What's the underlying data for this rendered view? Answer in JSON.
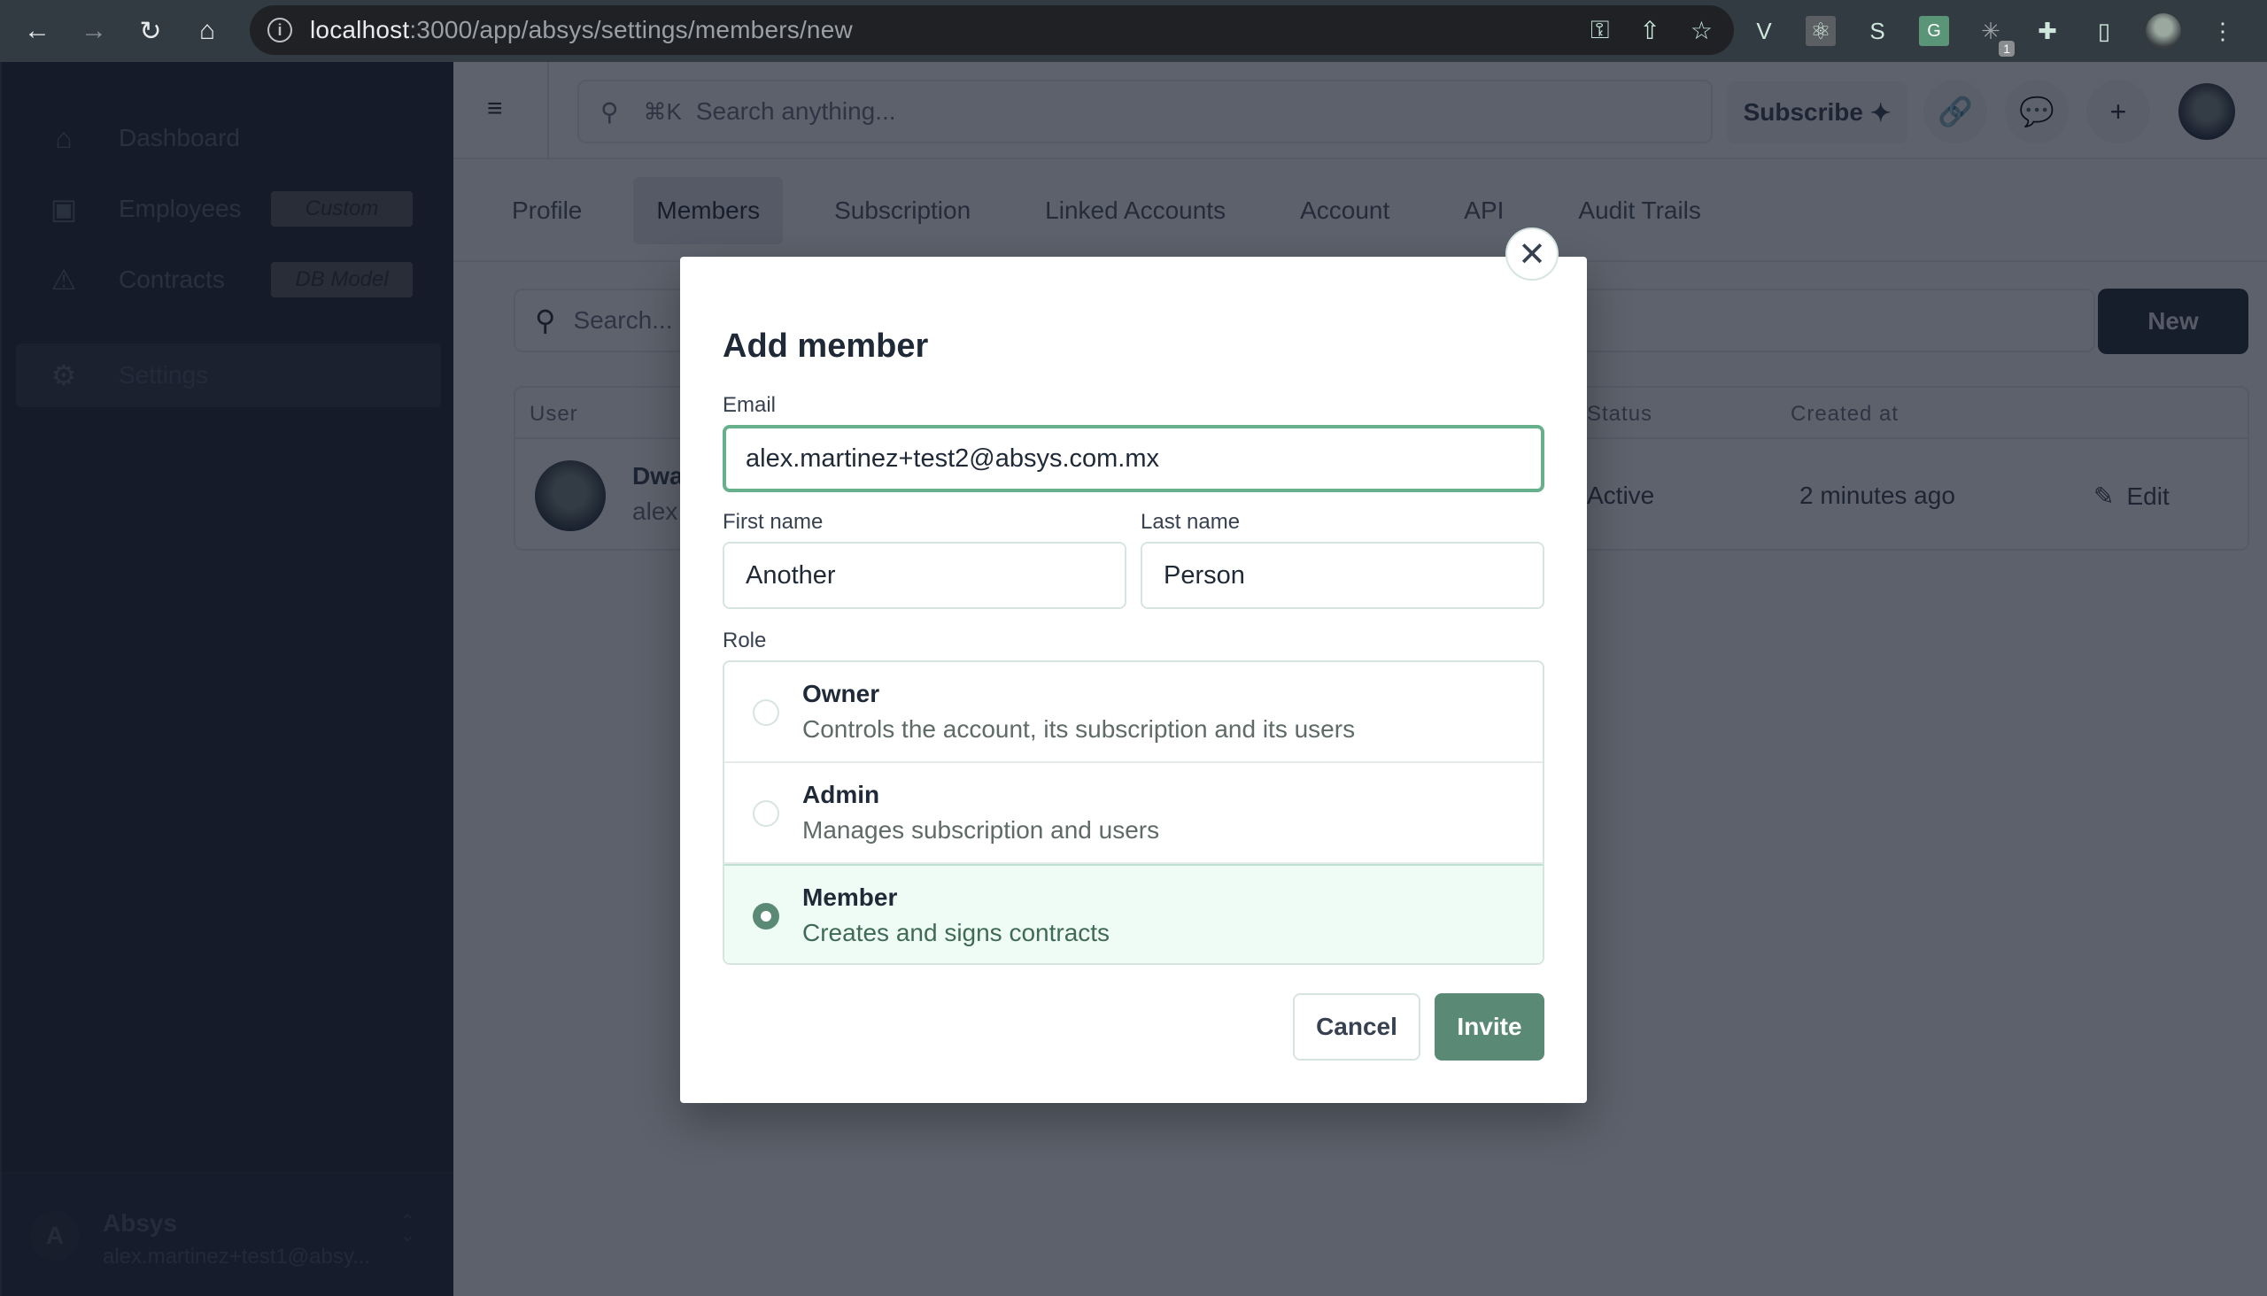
{
  "browser": {
    "url_host": "localhost",
    "url_rest": ":3000/app/absys/settings/members/new",
    "back_icon": "arrow-left",
    "forward_icon": "arrow-right",
    "reload_icon": "reload",
    "home_icon": "home",
    "extensions": [
      {
        "name": "vue-devtools",
        "glyph": "V"
      },
      {
        "name": "react-devtools",
        "glyph": "⚛"
      },
      {
        "name": "svelte-devtools",
        "glyph": "S"
      },
      {
        "name": "google-translate",
        "glyph": "G"
      },
      {
        "name": "extension-sparkle",
        "glyph": "✳",
        "badge": "1"
      },
      {
        "name": "extensions-puzzle",
        "glyph": "✚"
      },
      {
        "name": "side-panel",
        "glyph": "▯"
      }
    ],
    "menu_glyph": "⋮"
  },
  "sidebar": {
    "items": [
      {
        "label": "Dashboard",
        "icon": "⌂"
      },
      {
        "label": "Employees",
        "icon": "▣",
        "tag": "Custom"
      },
      {
        "label": "Contracts",
        "icon": "⚠",
        "tag": "DB Model"
      },
      {
        "label": "Settings",
        "icon": "⚙"
      }
    ],
    "footer": {
      "avatar_initial": "A",
      "org": "Absys",
      "email": "alex.martinez+test1@absy..."
    }
  },
  "topbar": {
    "search_kbd": "⌘K",
    "search_placeholder": "Search anything...",
    "subscribe_label": "Subscribe",
    "subscribe_icon": "✦"
  },
  "tabs": [
    {
      "label": "Profile",
      "active": false
    },
    {
      "label": "Members",
      "active": true
    },
    {
      "label": "Subscription",
      "active": false
    },
    {
      "label": "Linked Accounts",
      "active": false
    },
    {
      "label": "Account",
      "active": false
    },
    {
      "label": "API",
      "active": false
    },
    {
      "label": "Audit Trails",
      "active": false
    }
  ],
  "members": {
    "search_placeholder": "Search...",
    "new_label": "New",
    "columns": {
      "user": "User",
      "status": "Status",
      "created_at": "Created at"
    },
    "rows": [
      {
        "name": "Dwa",
        "email": "alex",
        "status": "Active",
        "created_at": "2 minutes ago",
        "action": "Edit"
      }
    ]
  },
  "modal": {
    "title": "Add member",
    "email_label": "Email",
    "email_value": "alex.martinez+test2@absys.com.mx",
    "first_name_label": "First name",
    "first_name_value": "Another",
    "last_name_label": "Last name",
    "last_name_value": "Person",
    "role_label": "Role",
    "roles": [
      {
        "name": "Owner",
        "description": "Controls the account, its subscription and its users",
        "selected": false
      },
      {
        "name": "Admin",
        "description": "Manages subscription and users",
        "selected": false
      },
      {
        "name": "Member",
        "description": "Creates and signs contracts",
        "selected": true
      }
    ],
    "cancel_label": "Cancel",
    "invite_label": "Invite"
  },
  "colors": {
    "accent": "#5a8a76",
    "focus_border": "#66b08b",
    "selected_bg": "#effcf5",
    "sidebar_bg": "#1f2433"
  }
}
